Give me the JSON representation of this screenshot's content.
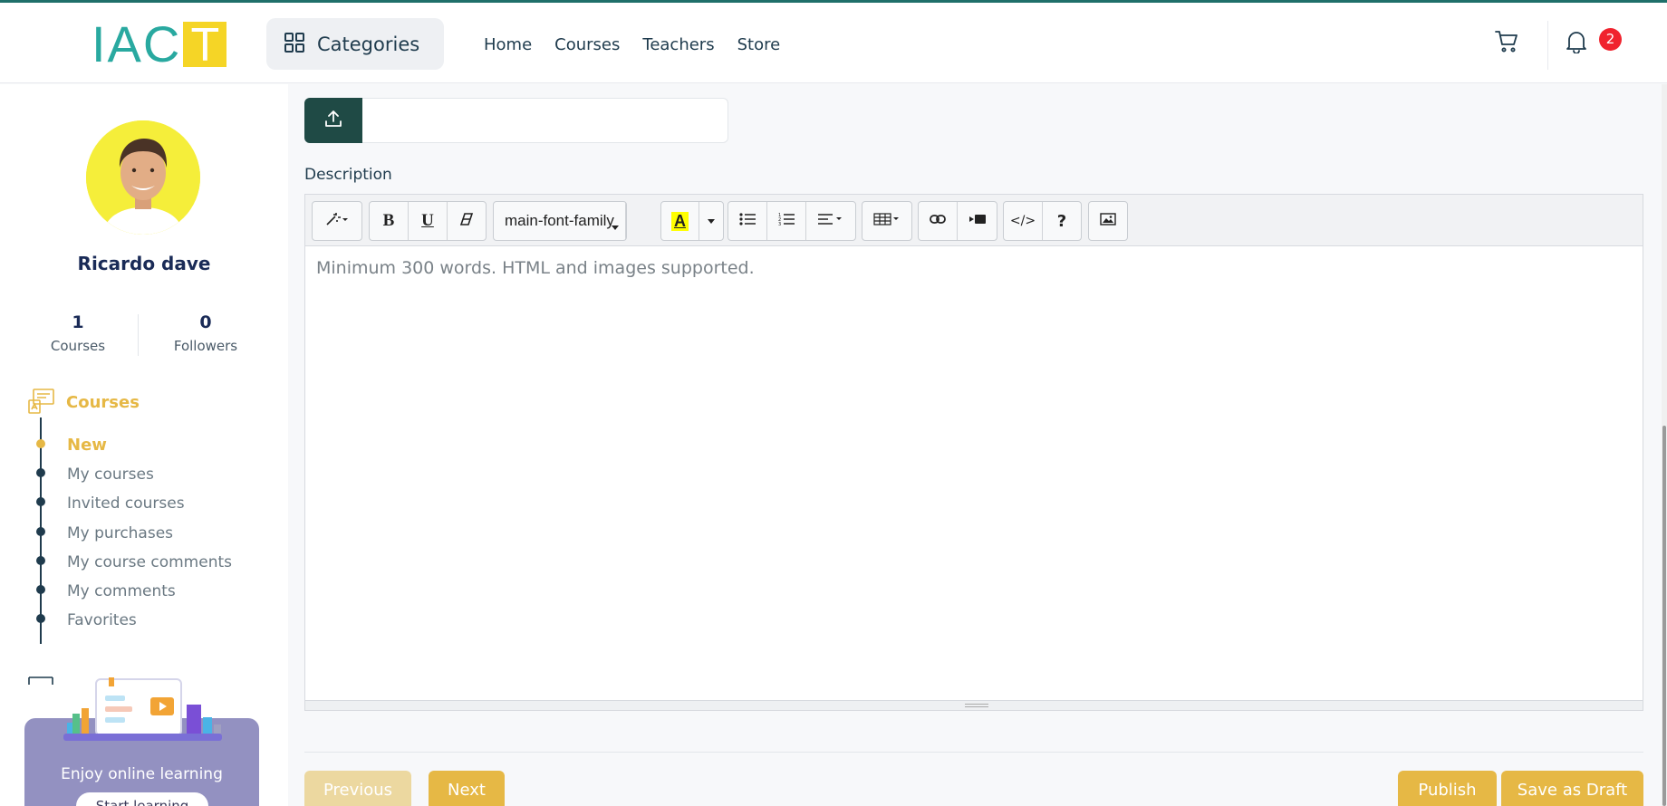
{
  "header": {
    "logo_text": "IAC",
    "logo_box_letter": "T",
    "categories_label": "Categories",
    "nav": [
      "Home",
      "Courses",
      "Teachers",
      "Store"
    ],
    "notification_count": "2"
  },
  "sidebar": {
    "user_name": "Ricardo dave",
    "stats": [
      {
        "value": "1",
        "label": "Courses"
      },
      {
        "value": "0",
        "label": "Followers"
      }
    ],
    "section_title": "Courses",
    "menu": [
      {
        "label": "New",
        "active": true
      },
      {
        "label": "My courses",
        "active": false
      },
      {
        "label": "Invited courses",
        "active": false
      },
      {
        "label": "My purchases",
        "active": false
      },
      {
        "label": "My course comments",
        "active": false
      },
      {
        "label": "My comments",
        "active": false
      },
      {
        "label": "Favorites",
        "active": false
      }
    ],
    "promo_text": "Enjoy online learning",
    "promo_button": "Start learning"
  },
  "main": {
    "description_label": "Description",
    "toolbar": {
      "bold": "B",
      "underline": "U",
      "font_family": "main-font-family",
      "color_letter": "A",
      "code_view": "</>",
      "help": "?"
    },
    "editor_placeholder": "Minimum 300 words. HTML and images supported.",
    "buttons": {
      "previous": "Previous",
      "next": "Next",
      "publish": "Publish",
      "save_draft": "Save as Draft"
    }
  },
  "colors": {
    "accent": "#e6b845",
    "primary_dark": "#1f4a45",
    "badge": "#f0232e",
    "logo_teal": "#29a9a0",
    "logo_yellow": "#f5d526"
  }
}
